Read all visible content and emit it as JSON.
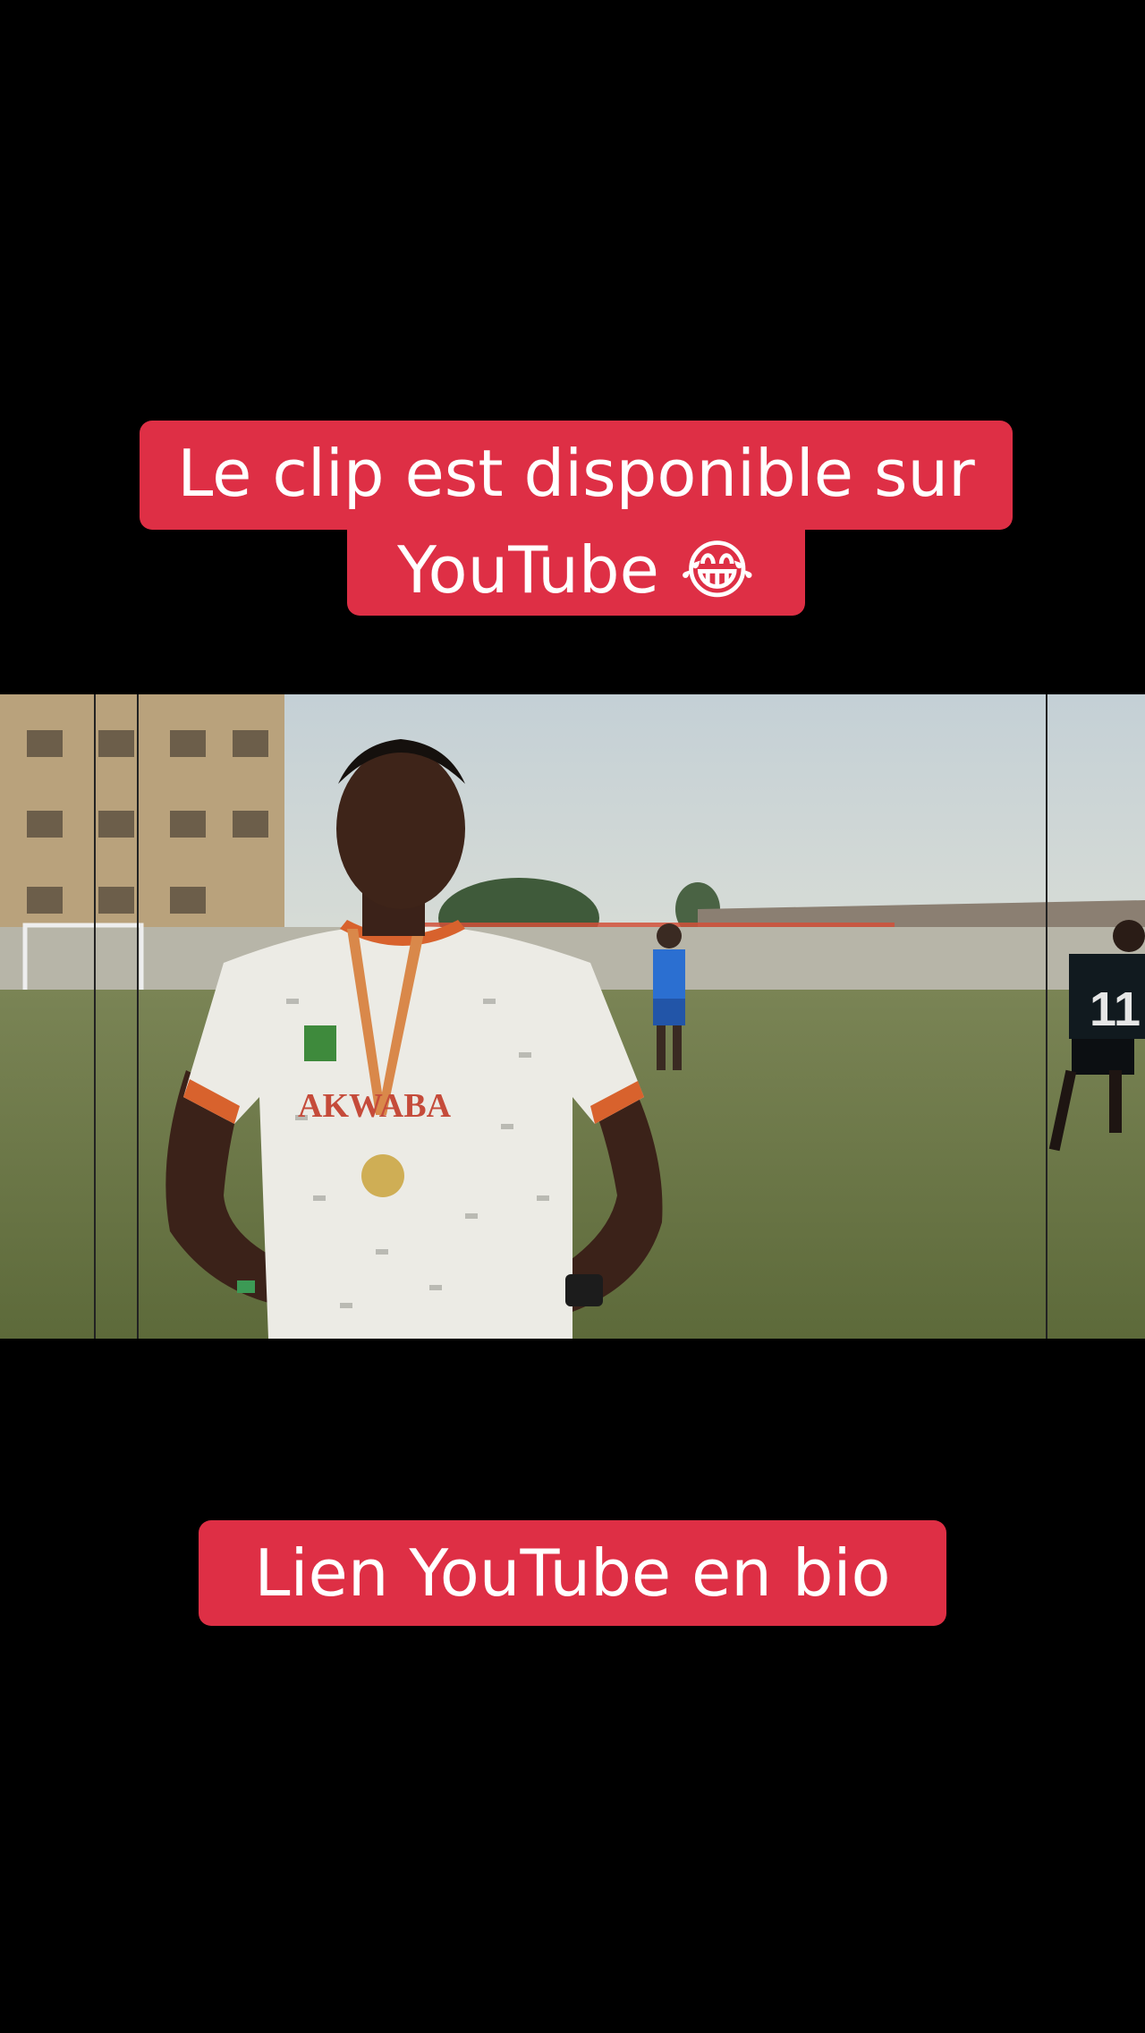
{
  "captions": {
    "line1": "Le clip est disponible sur",
    "line2": "YouTube 😂",
    "bottom": "Lien YouTube en bio"
  },
  "scene": {
    "jersey_text": "AKWABA",
    "player_number": "11"
  },
  "colors": {
    "background": "#000000",
    "caption_bg": "#de2f45",
    "caption_text": "#ffffff",
    "pitch": "#6f7a4a",
    "sky": "#c9d4d8"
  }
}
